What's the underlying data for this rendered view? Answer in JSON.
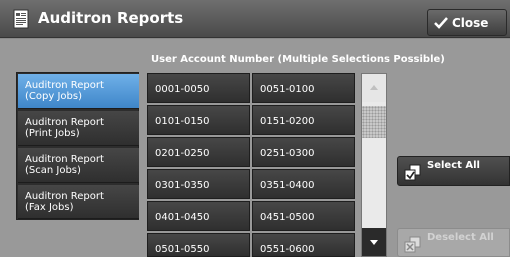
{
  "window": {
    "title": "Auditron Reports",
    "close_label": "Close"
  },
  "grid": {
    "header": "User Account Number (Multiple Selections Possible)",
    "cells": [
      "0001-0050",
      "0051-0100",
      "0101-0150",
      "0151-0200",
      "0201-0250",
      "0251-0300",
      "0301-0350",
      "0351-0400",
      "0401-0450",
      "0451-0500",
      "0501-0550",
      "0551-0600"
    ]
  },
  "tabs": [
    {
      "line1": "Auditron Report",
      "line2": "(Copy Jobs)",
      "active": true
    },
    {
      "line1": "Auditron Report",
      "line2": "(Print Jobs)",
      "active": false
    },
    {
      "line1": "Auditron Report",
      "line2": "(Scan Jobs)",
      "active": false
    },
    {
      "line1": "Auditron Report",
      "line2": "(Fax Jobs)",
      "active": false
    }
  ],
  "actions": {
    "select_all": "Select All",
    "deselect_all": "Deselect All"
  },
  "colors": {
    "accent": "#4a90d4",
    "panel": "#999999"
  },
  "icons": {
    "title": "report-icon",
    "close": "checkmark-icon",
    "select_all": "select-all-icon",
    "deselect_all": "deselect-all-icon"
  }
}
